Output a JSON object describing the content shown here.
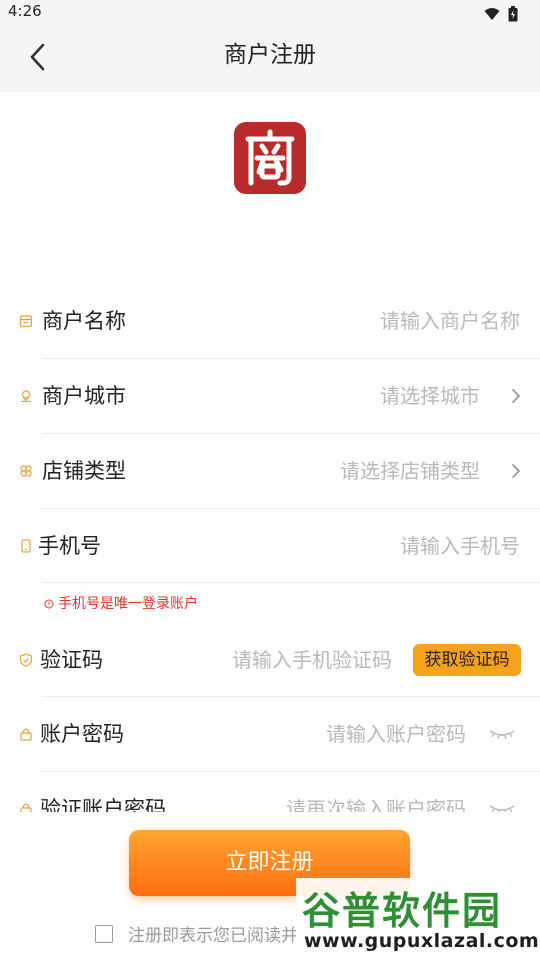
{
  "status_bar": {
    "time": "4:26"
  },
  "header": {
    "title": "商户注册"
  },
  "logo": {
    "glyph": "商",
    "color": "#b92a2a"
  },
  "form": {
    "merchant_name": {
      "label": "商户名称",
      "placeholder": "请输入商户名称"
    },
    "merchant_city": {
      "label": "商户城市",
      "placeholder": "请选择城市"
    },
    "store_type": {
      "label": "店铺类型",
      "placeholder": "请选择店铺类型"
    },
    "phone": {
      "label": "手机号",
      "placeholder": "请输入手机号",
      "hint": "手机号是唯一登录账户"
    },
    "code": {
      "label": "验证码",
      "placeholder": "请输入手机验证码",
      "button": "获取验证码"
    },
    "password": {
      "label": "账户密码",
      "placeholder": "请输入账户密码"
    },
    "confirm_password": {
      "label": "验证账户密码",
      "placeholder": "请再次输入账户密码"
    }
  },
  "submit": {
    "label": "立即注册"
  },
  "agreement": {
    "text": "注册即表示您已阅读并同意"
  },
  "watermark": {
    "title": "谷普软件园",
    "url": "www.gupuxlazal.com"
  },
  "colors": {
    "accent": "#f7a21b",
    "icon": "#e9a13b",
    "hint": "#e0352b"
  }
}
